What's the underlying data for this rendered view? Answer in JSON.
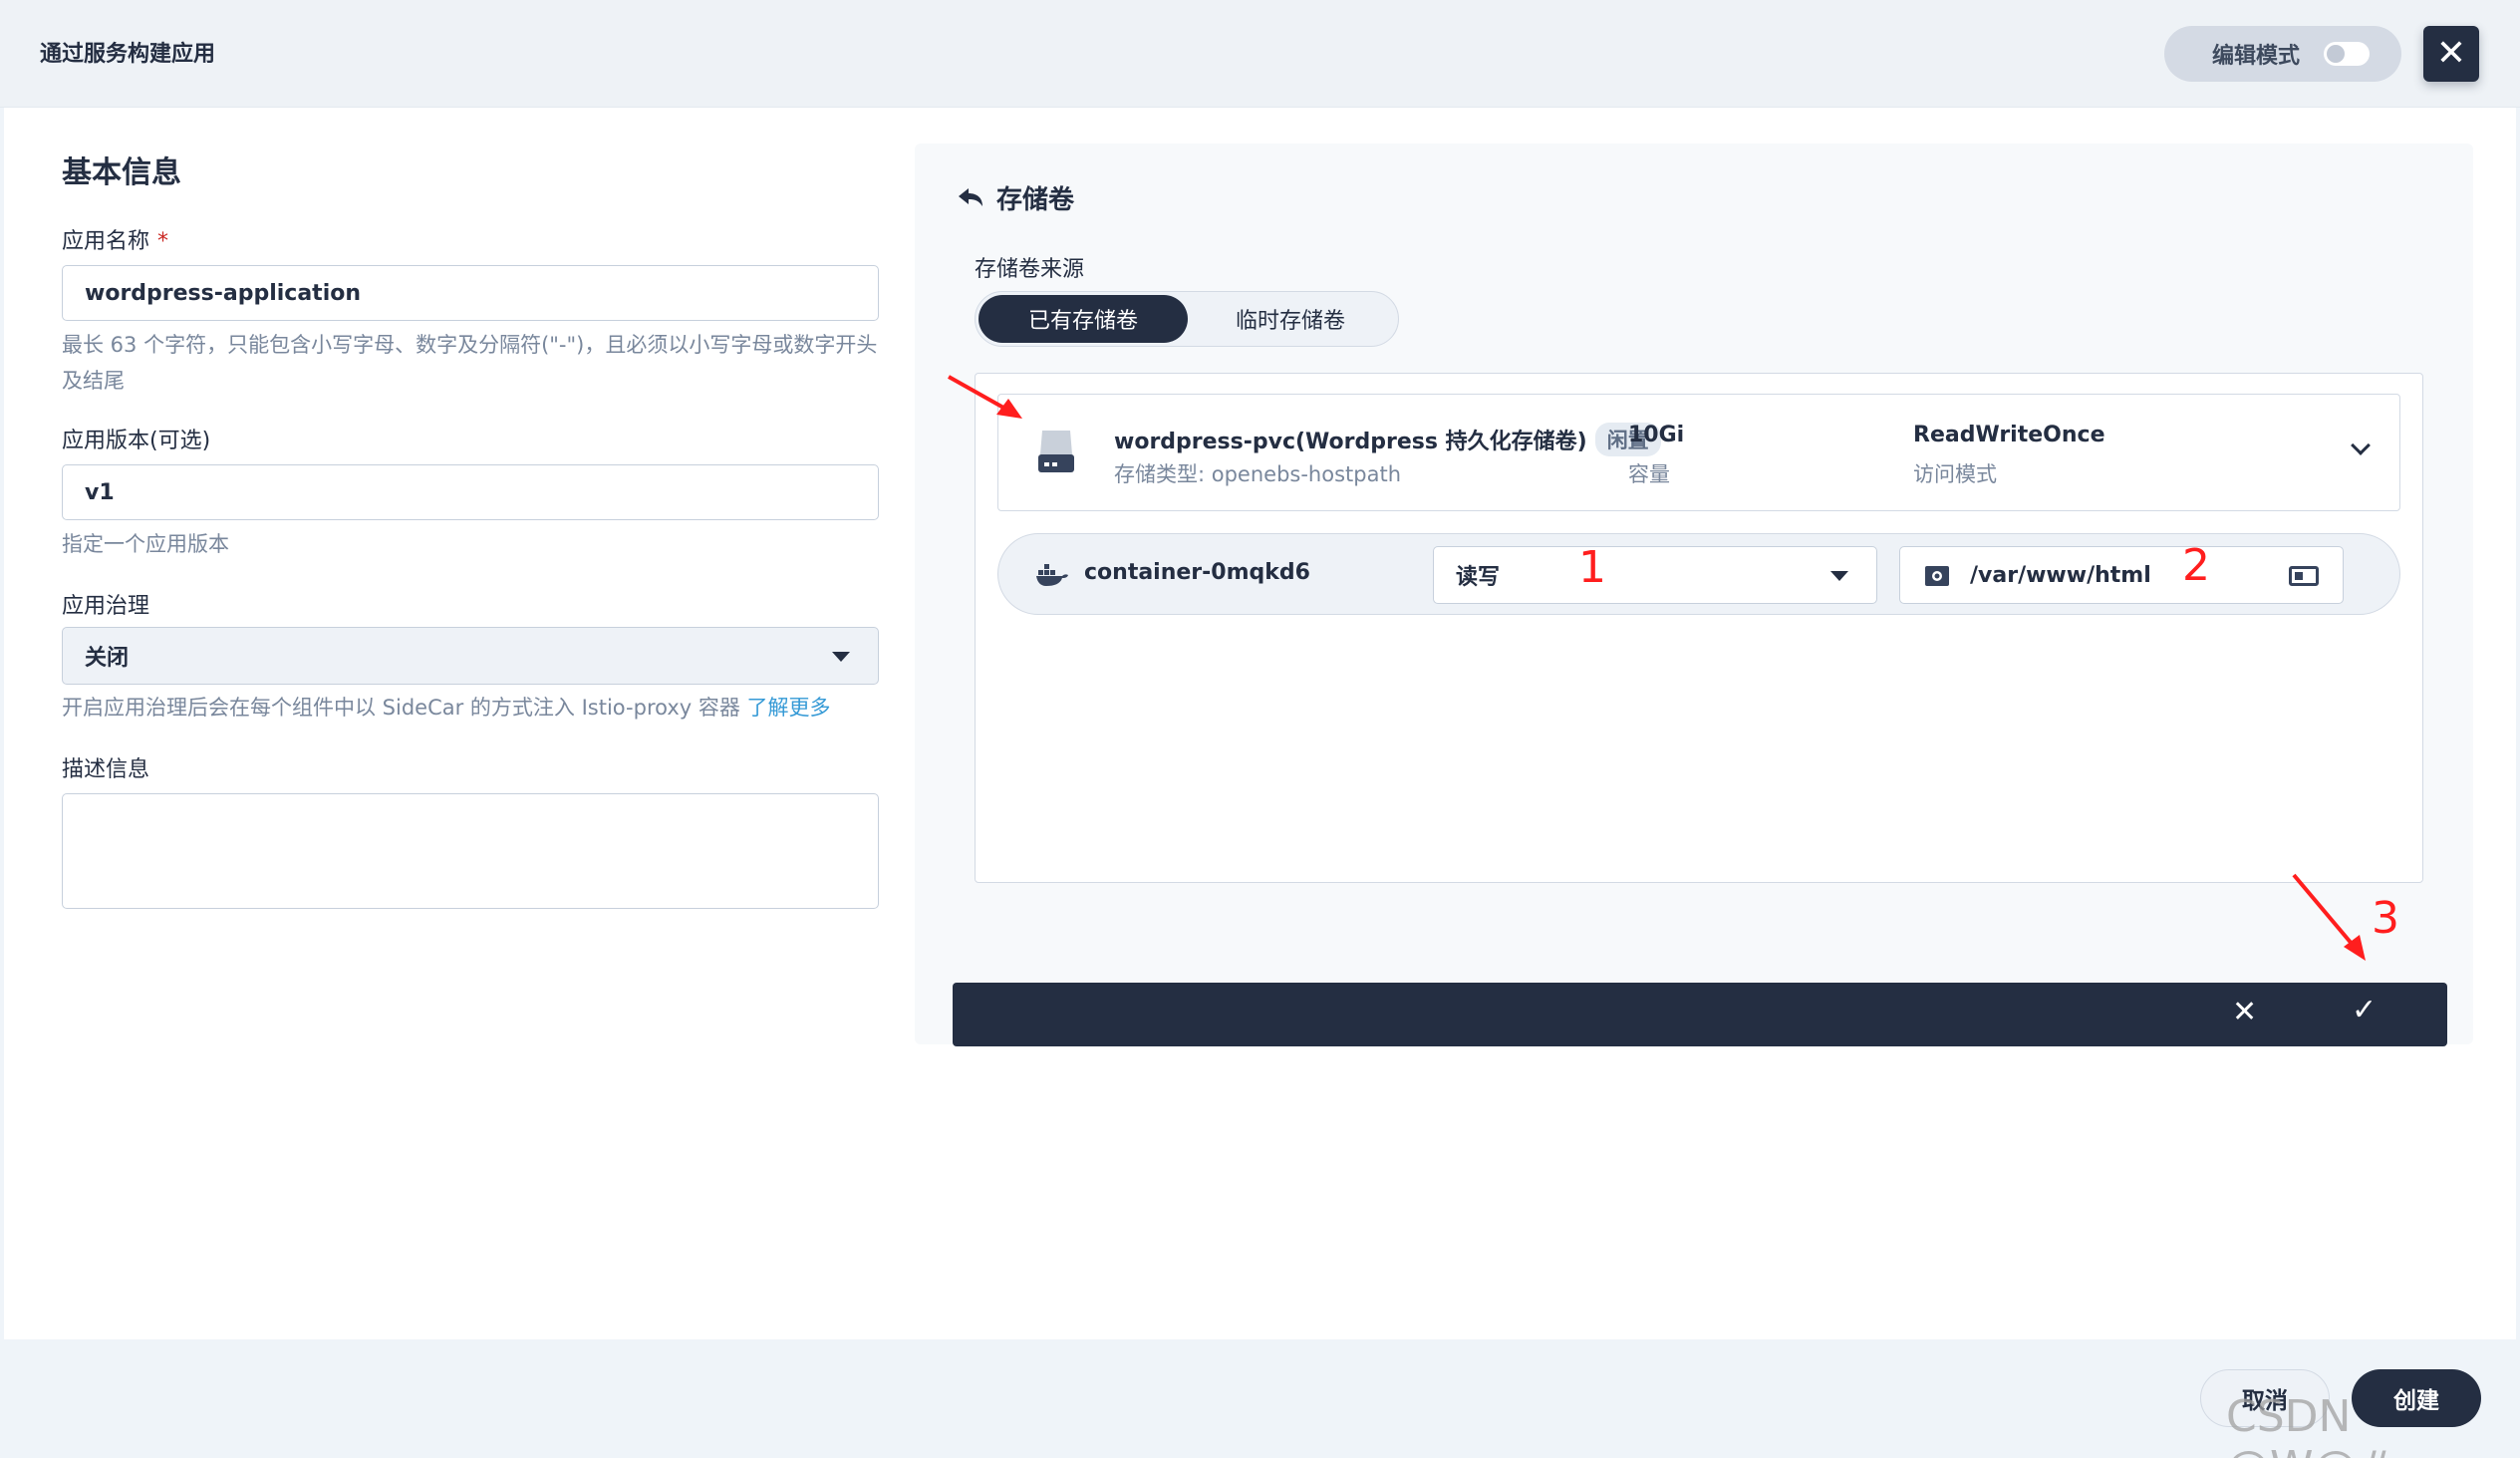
{
  "header": {
    "title": "通过服务构建应用",
    "edit_mode_label": "编辑模式",
    "close_icon": "close-icon"
  },
  "basic_info": {
    "section_title": "基本信息",
    "app_name_label": "应用名称",
    "app_name_required": "*",
    "app_name_value": "wordpress-application",
    "app_name_hint": "最长 63 个字符，只能包含小写字母、数字及分隔符(\"-\")，且必须以小写字母或数字开头及结尾",
    "version_label": "应用版本(可选)",
    "version_value": "v1",
    "version_hint": "指定一个应用版本",
    "governance_label": "应用治理",
    "governance_value": "关闭",
    "governance_hint": "开启应用治理后会在每个组件中以 SideCar 的方式注入 Istio-proxy 容器",
    "governance_link": "了解更多",
    "description_label": "描述信息",
    "description_value": ""
  },
  "volume_panel": {
    "back_title": "存储卷",
    "source_label": "存储卷来源",
    "source_tabs": [
      "已有存储卷",
      "临时存储卷"
    ],
    "active_tab": 0,
    "pvc": {
      "name": "wordpress-pvc(Wordpress 持久化存储卷)",
      "status": "闲置",
      "storage_class": "存储类型: openebs-hostpath",
      "capacity_value": "10Gi",
      "capacity_label": "容量",
      "access_mode_value": "ReadWriteOnce",
      "access_mode_label": "访问模式"
    },
    "mount": {
      "container_name": "container-0mqkd6",
      "access": "读写",
      "path": "/var/www/html"
    },
    "annotations": [
      "1",
      "2",
      "3"
    ]
  },
  "footer": {
    "cancel_label": "取消",
    "create_label": "创建",
    "watermark": "CSDN @W@#"
  },
  "colors": {
    "primary_dark": "#242e42",
    "link": "#369ad6",
    "annotation_red": "#ff1e1e"
  }
}
